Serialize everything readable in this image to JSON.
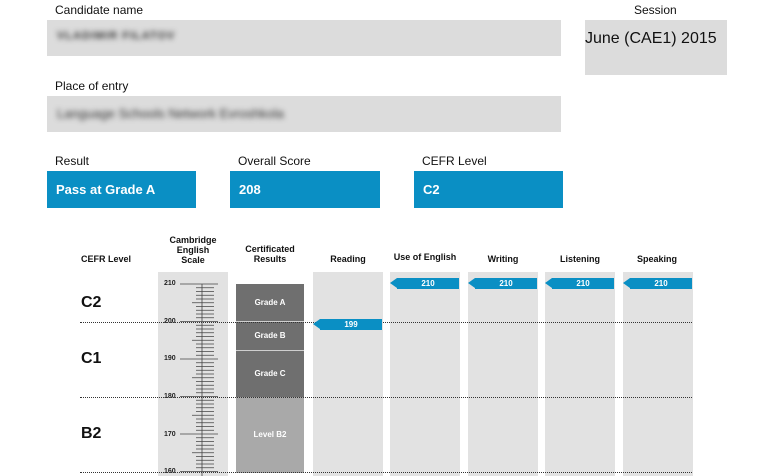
{
  "candidate": {
    "label": "Candidate name",
    "value_blurred": "VLADIMIR FILATOV"
  },
  "session": {
    "label": "Session",
    "value": "June (CAE1) 2015"
  },
  "place": {
    "label": "Place of entry",
    "value_blurred": "Language Schools Network Evroshkola"
  },
  "result": {
    "label": "Result",
    "value": "Pass at Grade A"
  },
  "overall": {
    "label": "Overall Score",
    "value": "208"
  },
  "cefr": {
    "label": "CEFR Level",
    "value": "C2"
  },
  "table": {
    "headers": {
      "cefr_level": "CEFR Level",
      "scale_line1": "Cambridge",
      "scale_line2": "English",
      "scale_line3": "Scale",
      "cert_line1": "Certificated",
      "cert_line2": "Results",
      "reading": "Reading",
      "use_of_english": "Use of English",
      "writing": "Writing",
      "listening": "Listening",
      "speaking": "Speaking"
    },
    "cefr_levels": [
      "C2",
      "C1",
      "B2"
    ],
    "scale_ticks": [
      "210",
      "200",
      "190",
      "180",
      "170",
      "160"
    ],
    "grades": [
      "Grade A",
      "Grade B",
      "Grade C",
      "Level B2"
    ],
    "scores": {
      "reading": "199",
      "use_of_english": "210",
      "writing": "210",
      "listening": "210",
      "speaking": "210"
    }
  },
  "colors": {
    "accent": "#0a8fc4",
    "field_bg": "#dcdcdc",
    "grade_dark": "#6f6f6f",
    "grade_light": "#a9a9a9"
  }
}
